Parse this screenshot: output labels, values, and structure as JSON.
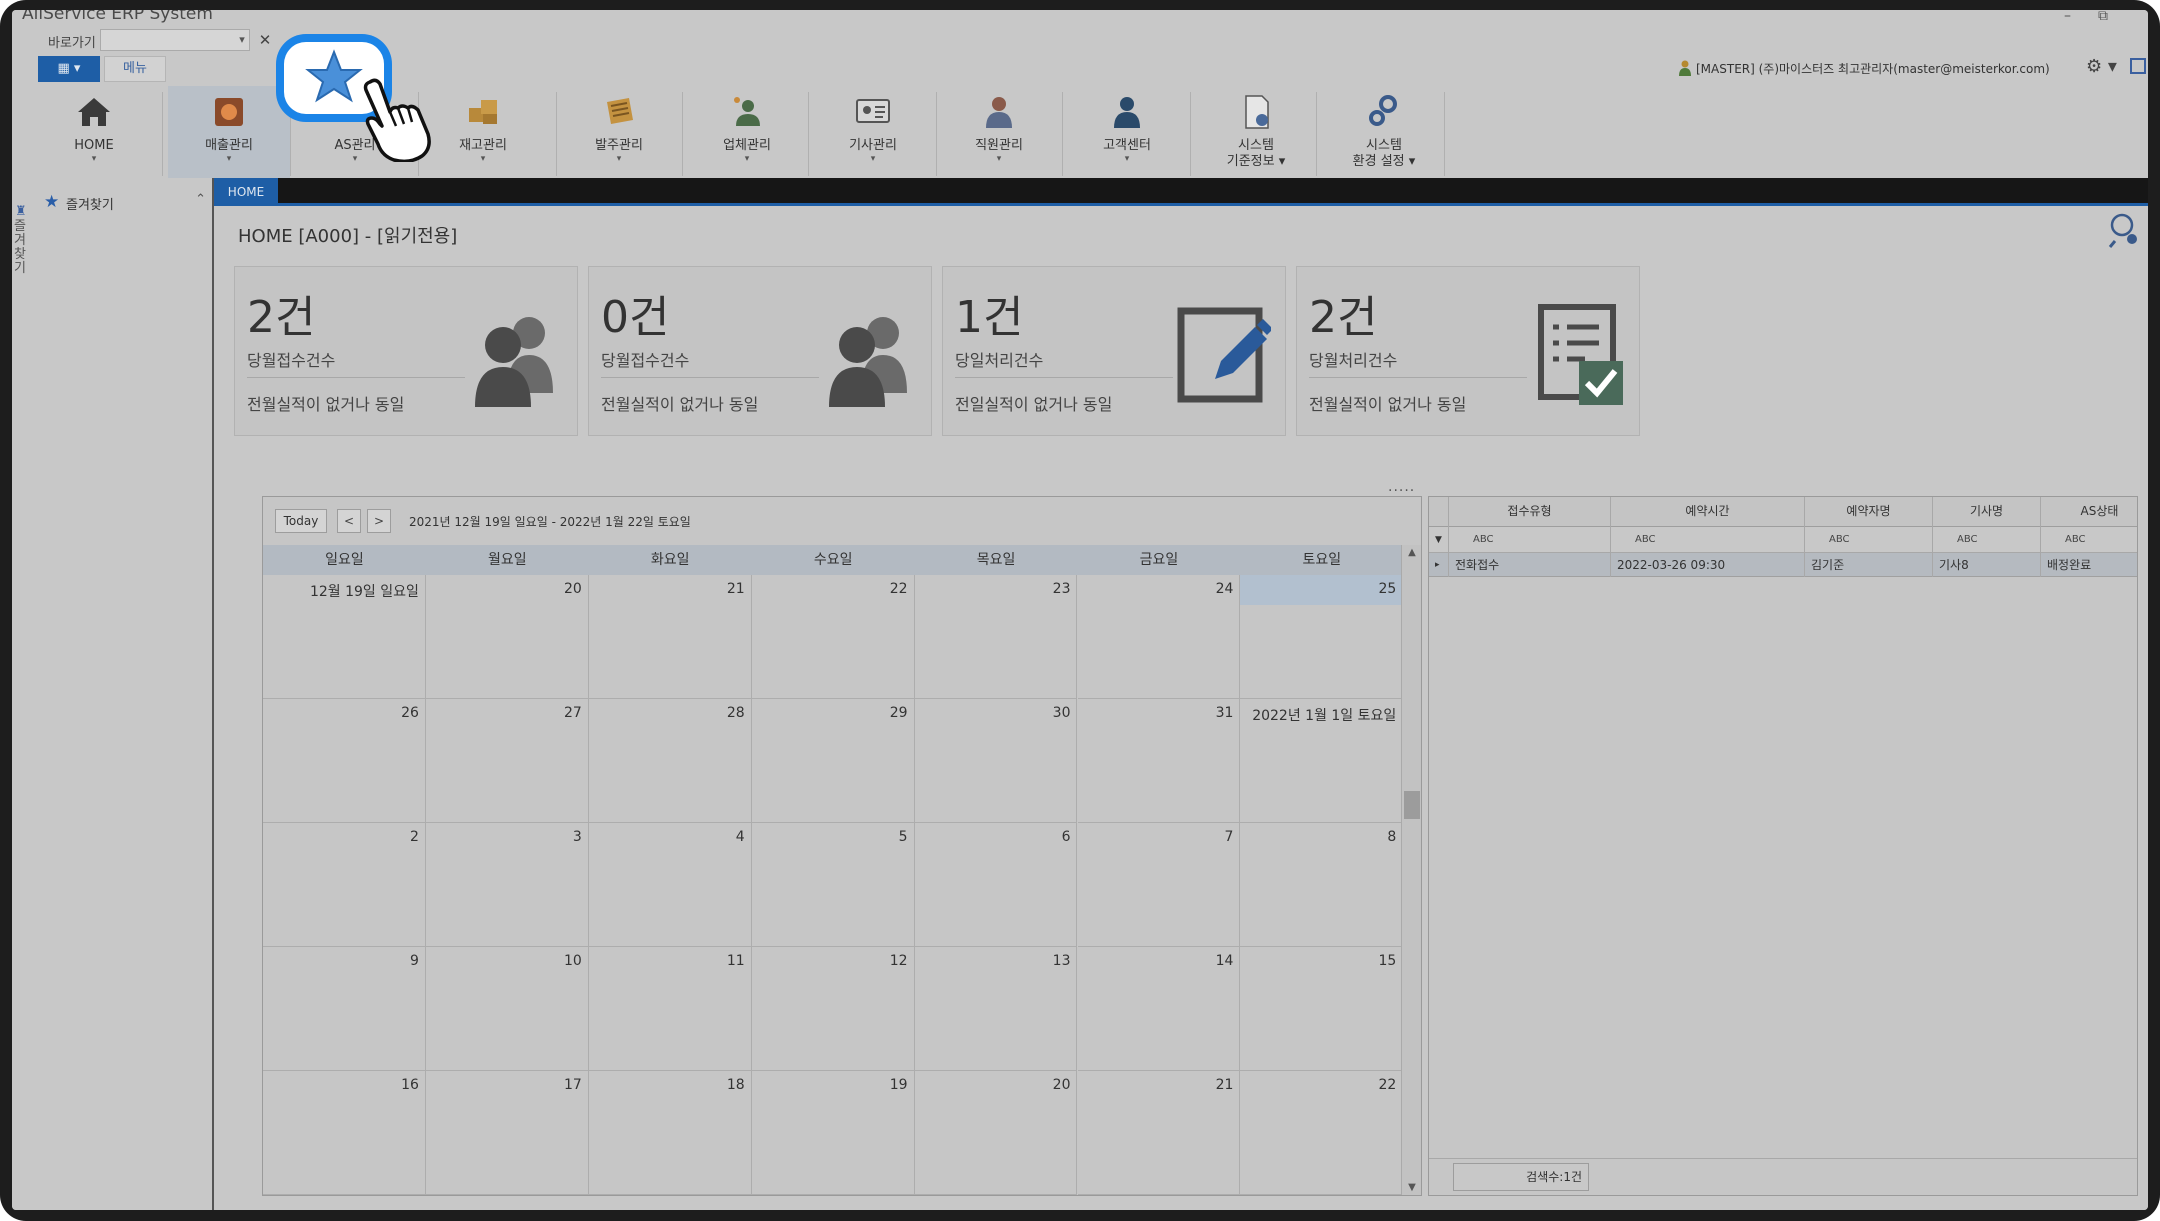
{
  "app": {
    "title": "AllService ERP System",
    "window_controls": [
      "–",
      "⧉"
    ]
  },
  "quick_go": {
    "label": "바로가기",
    "value": "",
    "dropdown": "▾",
    "close": "✕"
  },
  "menu_bar": {
    "menu_button": "▦ ▾",
    "menu_tab": "메뉴",
    "user_info": "[MASTER] (주)마이스터즈 최고관리자(master@meisterkor.com)",
    "settings": "⚙ ▾"
  },
  "ribbon": {
    "items": [
      {
        "label": "HOME",
        "icon": "home-icon"
      },
      {
        "label": "매출관리",
        "icon": "sales-icon"
      },
      {
        "label": "AS관리",
        "icon": "as-icon"
      },
      {
        "label": "재고관리",
        "icon": "inventory-icon"
      },
      {
        "label": "발주관리",
        "icon": "order-icon"
      },
      {
        "label": "업체관리",
        "icon": "company-icon"
      },
      {
        "label": "기사관리",
        "icon": "technician-icon"
      },
      {
        "label": "직원관리",
        "icon": "employee-icon"
      },
      {
        "label": "고객센터",
        "icon": "customer-center-icon"
      },
      {
        "label": "시스템\n기준정보 ▾",
        "icon": "system-info-icon"
      },
      {
        "label": "시스템\n환경 설정 ▾",
        "icon": "system-settings-icon"
      }
    ],
    "arrow": "▾"
  },
  "sidebar": {
    "vertical_tab": "즐겨찾기",
    "favorites_label": "즐겨찾기",
    "collapse": "⌃"
  },
  "doc_tabs": {
    "active": "HOME"
  },
  "page": {
    "title": "HOME [A000] - [읽기전용]"
  },
  "cards": [
    {
      "number": "2건",
      "title": "당월접수건수",
      "sub": "전월실적이 없거나 동일",
      "icon": "users-icon"
    },
    {
      "number": "0건",
      "title": "당월접수건수",
      "sub": "전월실적이 없거나 동일",
      "icon": "users-icon"
    },
    {
      "number": "1건",
      "title": "당일처리건수",
      "sub": "전일실적이 없거나 동일",
      "icon": "edit-icon"
    },
    {
      "number": "2건",
      "title": "당월처리건수",
      "sub": "전월실적이 없거나 동일",
      "icon": "checklist-icon"
    }
  ],
  "splitter": ".....",
  "calendar": {
    "today_button": "Today",
    "prev": "<",
    "next": ">",
    "range": "2021년 12월 19일 일요일 - 2022년 1월 22일 토요일",
    "weekdays": [
      "일요일",
      "월요일",
      "화요일",
      "수요일",
      "목요일",
      "금요일",
      "토요일"
    ],
    "weeks": [
      [
        "12월 19일 일요일",
        "20",
        "21",
        "22",
        "23",
        "24",
        "25"
      ],
      [
        "26",
        "27",
        "28",
        "29",
        "30",
        "31",
        "2022년 1월 1일 토요일"
      ],
      [
        "2",
        "3",
        "4",
        "5",
        "6",
        "7",
        "8"
      ],
      [
        "9",
        "10",
        "11",
        "12",
        "13",
        "14",
        "15"
      ],
      [
        "16",
        "17",
        "18",
        "19",
        "20",
        "21",
        "22"
      ]
    ],
    "highlighted_day": "25",
    "scroll_up": "▲",
    "scroll_down": "▼"
  },
  "grid": {
    "columns": [
      "접수유형",
      "예약시간",
      "예약자명",
      "기사명",
      "AS상태"
    ],
    "filter_icon": "▼",
    "filter_text": "ABC",
    "rows": [
      {
        "expander": "▸",
        "cells": [
          "전화접수",
          "2022-03-26 09:30",
          "김기준",
          "기사8",
          "배정완료"
        ]
      }
    ],
    "footer": "검색수:1건"
  },
  "colors": {
    "accent": "#1e5ea6",
    "background": "#c8c8c8",
    "bubble": "#1b84e7"
  }
}
